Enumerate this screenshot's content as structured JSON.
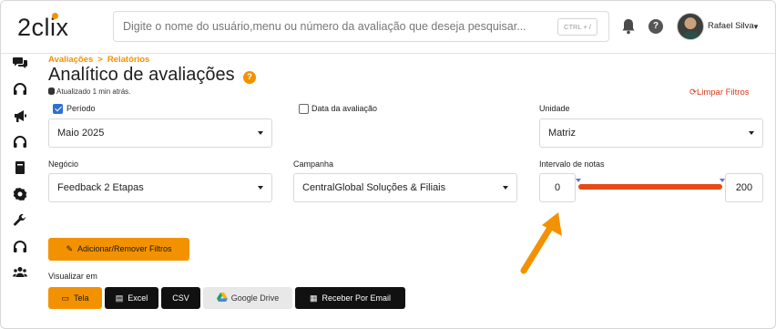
{
  "app": {
    "logo_text": "2clix"
  },
  "search": {
    "placeholder": "Digite o nome do usuário,menu ou número da avaliação que deseja pesquisar...",
    "shortcut": "CTRL + /"
  },
  "user": {
    "name": "Rafael Silva"
  },
  "sidebar": {
    "icons": [
      "chat-icon",
      "headset-icon",
      "megaphone-icon",
      "headset-icon",
      "book-icon",
      "badge-icon",
      "wrench-icon",
      "headset-icon",
      "users-icon"
    ]
  },
  "breadcrumb": {
    "items": [
      "Avaliações",
      "Relatórios"
    ],
    "separator": ">"
  },
  "page": {
    "title": "Analítico de avaliações",
    "help": "?",
    "updated": "Atualizado 1 min atrás.",
    "clear_filters": "Limpar Filtros"
  },
  "filters": {
    "periodo": {
      "label": "Período",
      "checked": true,
      "value": "Maio 2025"
    },
    "data_avaliacao": {
      "label": "Data da avaliação",
      "checked": false
    },
    "unidade": {
      "label": "Unidade",
      "value": "Matriz"
    },
    "negocio": {
      "label": "Negócio",
      "value": "Feedback 2 Etapas"
    },
    "campanha": {
      "label": "Campanha",
      "value": "CentralGlobal Soluções & Filiais"
    },
    "intervalo": {
      "label": "Intervalo de notas",
      "min": "0",
      "max": "200",
      "range_fraction": [
        0,
        1
      ]
    }
  },
  "actions": {
    "add_remove_filters": "Adicionar/Remover Filtros"
  },
  "view": {
    "label": "Visualizar em",
    "options": [
      {
        "label": "Tela",
        "icon": "monitor-icon",
        "active": true
      },
      {
        "label": "Excel",
        "icon": "file-icon"
      },
      {
        "label": "CSV",
        "icon": ""
      },
      {
        "label": "Google Drive",
        "icon": "google-drive-icon"
      },
      {
        "label": "Receber Por Email",
        "icon": "calendar-icon"
      }
    ]
  },
  "colors": {
    "accent": "#f39200",
    "danger": "#d9391c",
    "slider": "#e64a19",
    "dark_button": "#111111"
  }
}
